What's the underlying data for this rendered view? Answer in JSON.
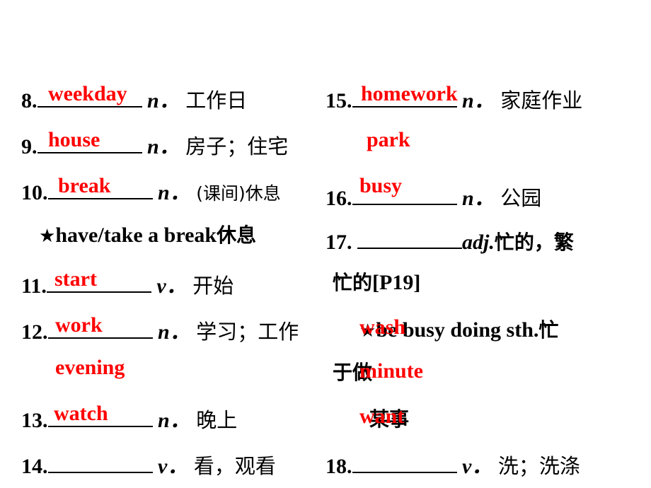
{
  "slide": {
    "left_column": {
      "entries": [
        {
          "number": "8.",
          "answer": "weekday",
          "pos": "n．",
          "meaning": "工作日"
        },
        {
          "number": "9.",
          "answer": "house",
          "pos": "n．",
          "meaning": "房子；住宅"
        },
        {
          "number": "10.",
          "answer": "break",
          "pos": "n．",
          "meaning": "(课间)休息"
        },
        {
          "number": "11.",
          "answer": "start",
          "pos": "v．",
          "meaning": "开始"
        },
        {
          "number": "12.",
          "answer": "work",
          "pos": "n．",
          "meaning": "学习；工作"
        },
        {
          "number": "13.",
          "answer": "watch",
          "pos": "n．",
          "meaning": "晚上"
        },
        {
          "number": "14.",
          "answer": "",
          "pos": "v．",
          "meaning": "看，观看"
        }
      ],
      "phrase_note": {
        "star": "★",
        "text": "have/take a break",
        "meaning": "休息"
      },
      "stray_answers": [
        "evening"
      ]
    },
    "right_column": {
      "entries": [
        {
          "number": "15.",
          "answer": "homework",
          "pos": "n．",
          "meaning": "家庭作业"
        },
        {
          "number": "16.",
          "answer": "busy",
          "pos": "n．",
          "meaning": "公园"
        },
        {
          "number": "17.",
          "answer": "",
          "pos": "adj.",
          "meaning": "忙的，繁忙的[P19]"
        },
        {
          "number": "18.",
          "answer": "",
          "pos": "v．",
          "meaning": "洗；洗涤"
        }
      ],
      "phrase_note": {
        "star": "★",
        "text": "be busy doing sth.",
        "meaning": "忙于做某事"
      },
      "stray_answers": [
        "park",
        "wash",
        "minute",
        "want"
      ]
    },
    "colors": {
      "answer_red": "#ff0000",
      "text_black": "#000000",
      "background": "#ffffff"
    }
  }
}
